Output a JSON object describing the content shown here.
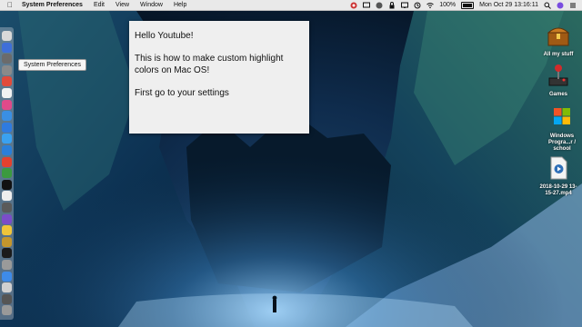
{
  "menubar": {
    "apple_icon": "apple-icon",
    "app_name": "System Preferences",
    "menus": [
      "Edit",
      "View",
      "Window",
      "Help"
    ],
    "battery": "100%",
    "clock": "Mon Oct 29  13:16:11"
  },
  "dock": {
    "tooltip": "System Preferences",
    "icon_colors": [
      "#d9d9d9",
      "#3f6fd8",
      "#6b6b6b",
      "#8a8a8a",
      "#e14b3b",
      "#f2f2f2",
      "#e04a8a",
      "#3a8fe3",
      "#2f7be0",
      "#3aa1f0",
      "#2b7fd9",
      "#e3412e",
      "#3b9a3f",
      "#111111",
      "#eeeeee",
      "#5a5a5a",
      "#7b4dc9",
      "#f0c53a",
      "#c4962d",
      "#1b1b1b",
      "#9a9a9a",
      "#3e8be8",
      "#d0d0d0",
      "#555555",
      "#999999"
    ]
  },
  "note": {
    "line1": "Hello Youtube!",
    "line2": "This is how to make custom highlight colors on Mac OS!",
    "line3": "First go to your settings"
  },
  "desktop": {
    "items": [
      {
        "label": "All my stuff",
        "icon": "treasure-chest-icon"
      },
      {
        "label": "Games",
        "icon": "joystick-icon"
      },
      {
        "label": "Windows Progra...r / school",
        "icon": "windows-icon"
      },
      {
        "label": "2018-10-29 13-15-27.mp4",
        "icon": "video-file-icon"
      }
    ]
  }
}
